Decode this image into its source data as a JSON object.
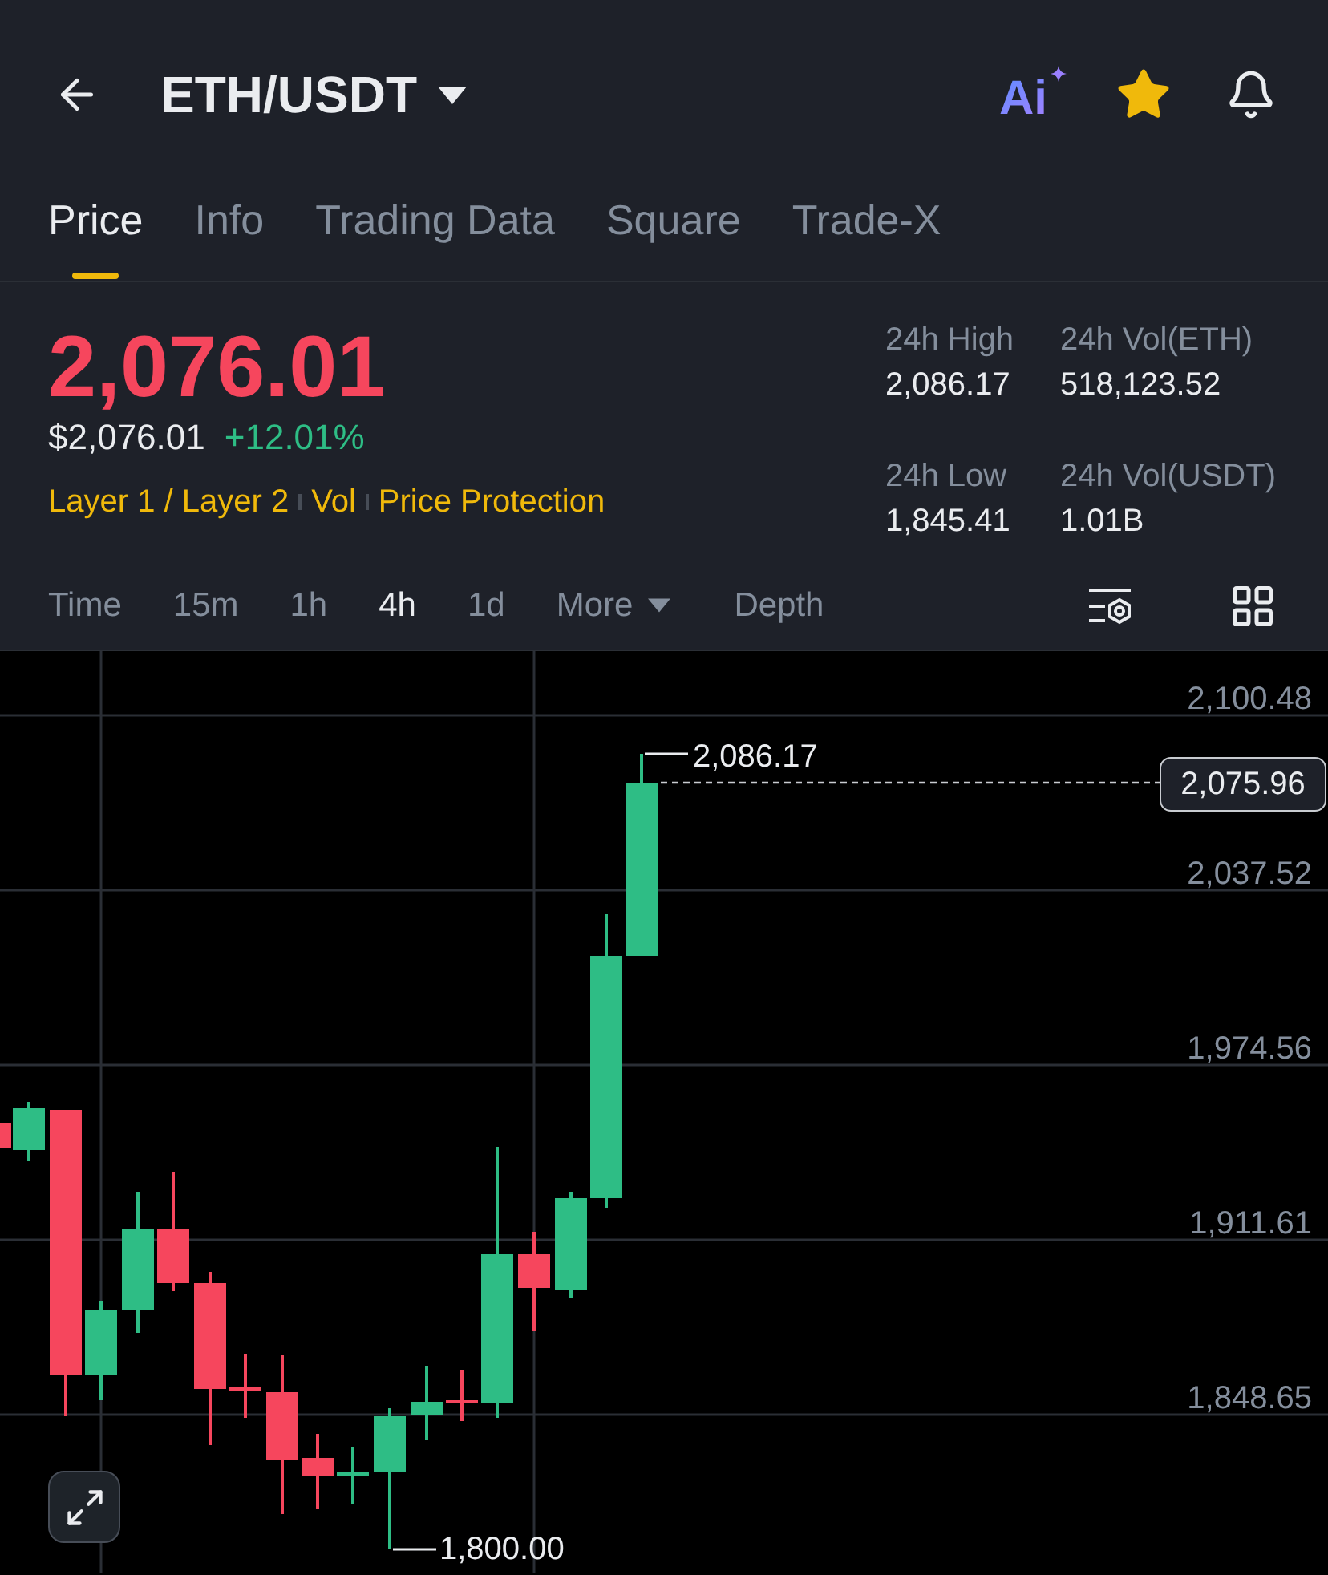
{
  "header": {
    "title": "ETH/USDT",
    "ai_label": "Ai",
    "favorite": true
  },
  "tabs": [
    {
      "label": "Price",
      "selected": true
    },
    {
      "label": "Info",
      "selected": false
    },
    {
      "label": "Trading Data",
      "selected": false
    },
    {
      "label": "Square",
      "selected": false
    },
    {
      "label": "Trade-X",
      "selected": false
    }
  ],
  "ticker": {
    "last_price": "2,076.01",
    "fiat_price": "$2,076.01",
    "change": "+12.01%",
    "tags": [
      "Layer 1 / Layer 2",
      "Vol",
      "Price Protection"
    ]
  },
  "stats": [
    {
      "label": "24h High",
      "value": "2,086.17"
    },
    {
      "label": "24h Vol(ETH)",
      "value": "518,123.52"
    },
    {
      "label": "24h Low",
      "value": "1,845.41"
    },
    {
      "label": "24h Vol(USDT)",
      "value": "1.01B"
    }
  ],
  "intervals": [
    {
      "label": "Time",
      "kind": "interval",
      "selected": false
    },
    {
      "label": "15m",
      "kind": "interval",
      "selected": false
    },
    {
      "label": "1h",
      "kind": "interval",
      "selected": false
    },
    {
      "label": "4h",
      "kind": "interval",
      "selected": true
    },
    {
      "label": "1d",
      "kind": "interval",
      "selected": false
    },
    {
      "label": "More",
      "kind": "menu",
      "selected": false
    },
    {
      "label": "Depth",
      "kind": "view",
      "selected": false
    }
  ],
  "chart": {
    "price_labels": [
      "2,100.48",
      "2,037.52",
      "1,974.56",
      "1,911.61",
      "1,848.65"
    ],
    "high_label": "2,086.17",
    "low_label": "1,800.00",
    "last_price_tag": "2,075.96"
  }
}
